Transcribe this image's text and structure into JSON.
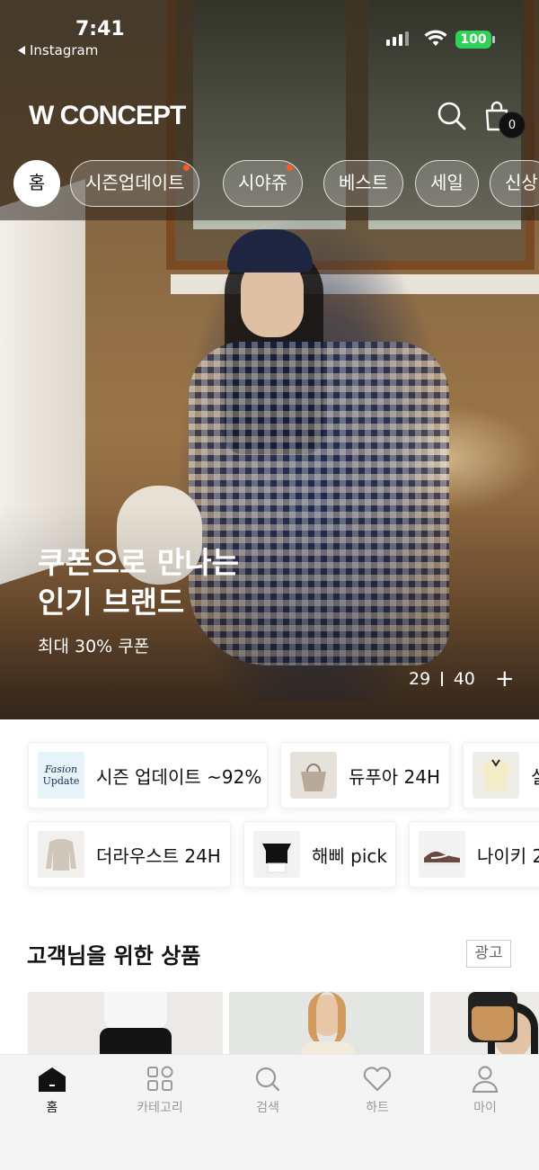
{
  "status_bar": {
    "time": "7:41",
    "back_app": "Instagram",
    "battery": "100"
  },
  "header": {
    "logo": "W CONCEPT",
    "cart_count": "0"
  },
  "categories": [
    {
      "label": "홈",
      "active": true,
      "dot": false
    },
    {
      "label": "시즌업데이트",
      "active": false,
      "dot": true
    },
    {
      "label": "시야쥬",
      "active": false,
      "dot": true
    },
    {
      "label": "베스트",
      "active": false,
      "dot": false
    },
    {
      "label": "세일",
      "active": false,
      "dot": false
    },
    {
      "label": "신상",
      "active": false,
      "dot": false
    }
  ],
  "hero": {
    "title_line1": "쿠폰으로 만나는",
    "title_line2": "인기 브랜드",
    "subtitle": "최대 30% 쿠폰",
    "page_current": "29",
    "page_total": "40",
    "plus": "+"
  },
  "shortcuts": {
    "row1": [
      {
        "label": "시즌 업데이트 ~92%",
        "thumb": "fashion-update",
        "thumb_text_1": "Fasion",
        "thumb_text_2": "Update"
      },
      {
        "label": "듀푸아 24H",
        "thumb": "bag"
      },
      {
        "label": "실",
        "thumb": "polo-shirt"
      }
    ],
    "row2": [
      {
        "label": "더라우스트 24H",
        "thumb": "knit-cardigan"
      },
      {
        "label": "해삐 pick",
        "thumb": "off-shoulder-top"
      },
      {
        "label": "나이키 2",
        "thumb": "sneaker"
      }
    ]
  },
  "recommend": {
    "title": "고객님을 위한 상품",
    "ad_label": "광고"
  },
  "tabbar": [
    {
      "label": "홈",
      "icon": "home-icon",
      "active": true
    },
    {
      "label": "카테고리",
      "icon": "category-grid-icon",
      "active": false
    },
    {
      "label": "검색",
      "icon": "search-icon",
      "active": false
    },
    {
      "label": "하트",
      "icon": "heart-icon",
      "active": false
    },
    {
      "label": "마이",
      "icon": "person-icon",
      "active": false
    }
  ]
}
